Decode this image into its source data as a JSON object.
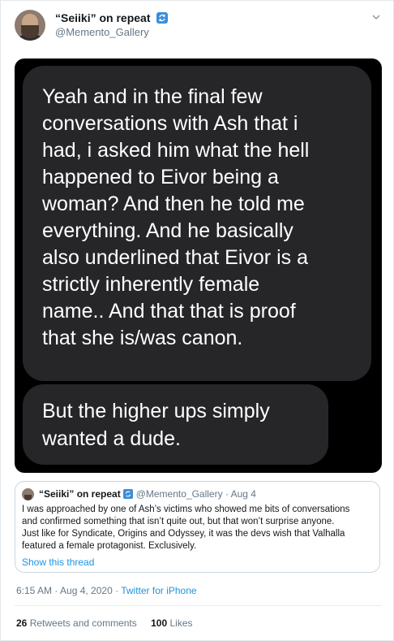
{
  "tweet": {
    "author": {
      "display_name": "“Seiiki” on repeat",
      "handle": "@Memento_Gallery",
      "badge_icon": "sync-badge-icon"
    },
    "menu_icon": "chevron-down-icon",
    "media": {
      "bubbles": [
        {
          "lines": [
            "Yeah and in the final few",
            "conversations with Ash that i",
            "had, i asked him what the hell",
            "happened to Eivor being a",
            "woman? And then he told me",
            "everything. And he basically",
            "also underlined that Eivor is a",
            "strictly inherently female",
            "name.. And that that is proof",
            "that she is/was canon."
          ]
        },
        {
          "lines": [
            "But the higher ups simply",
            "wanted a dude."
          ]
        }
      ],
      "colors": {
        "background": "#000000",
        "bubble": "#262628",
        "text": "#ffffff"
      }
    },
    "quoted_tweet": {
      "display_name": "“Seiiki” on repeat",
      "handle": "@Memento_Gallery",
      "date": "· Aug 4",
      "text_lines": [
        "I was approached by one of Ash’s victims who showed me bits of conversations",
        "and confirmed something that isn’t quite out, but that won’t surprise anyone.",
        "Just like for Syndicate, Origins and Odyssey, it was the devs wish that Valhalla",
        "featured a female protagonist. Exclusively."
      ],
      "show_thread": "Show this thread"
    },
    "timestamp": "6:15 AM · Aug 4, 2020 · ",
    "client": "Twitter for iPhone",
    "stats": {
      "retweets_count": "26",
      "retweets_label": "Retweets and comments",
      "likes_count": "100",
      "likes_label": "Likes"
    },
    "colors": {
      "link": "#1b95e0",
      "secondary_text": "#657786",
      "verified_badge": "#3b8ed9"
    }
  }
}
